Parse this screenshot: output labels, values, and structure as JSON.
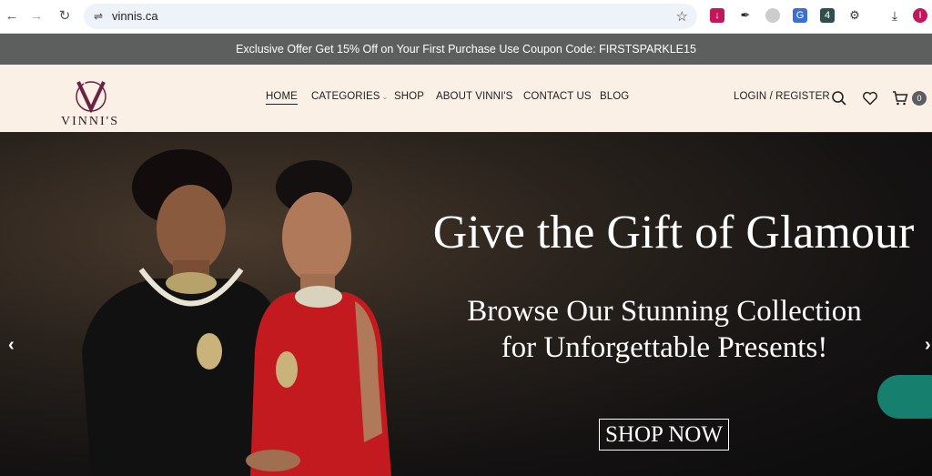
{
  "browser": {
    "url": "vinnis.ca",
    "profile_initial": "I"
  },
  "promo": {
    "text": "Exclusive Offer Get 15% Off on Your First Purchase Use Coupon Code: FIRSTSPARKLE15"
  },
  "header": {
    "logo_text": "VINNI'S",
    "nav": {
      "home": "HOME",
      "categories": "CATEGORIES",
      "shop": "SHOP",
      "about": "ABOUT VINNI'S",
      "contact": "CONTACT US",
      "blog": "BLOG"
    },
    "login": "LOGIN / REGISTER",
    "cart_count": "0"
  },
  "hero": {
    "title": "Give the Gift of Glamour",
    "subtitle_line1": "Browse Our Stunning Collection",
    "subtitle_line2": "for Unforgettable Presents!",
    "cta": "SHOP NOW"
  },
  "colors": {
    "promo_bg": "#5d5e5e",
    "header_bg": "#fbf0e6",
    "brand": "#6b2140",
    "chat": "#177f6d"
  }
}
